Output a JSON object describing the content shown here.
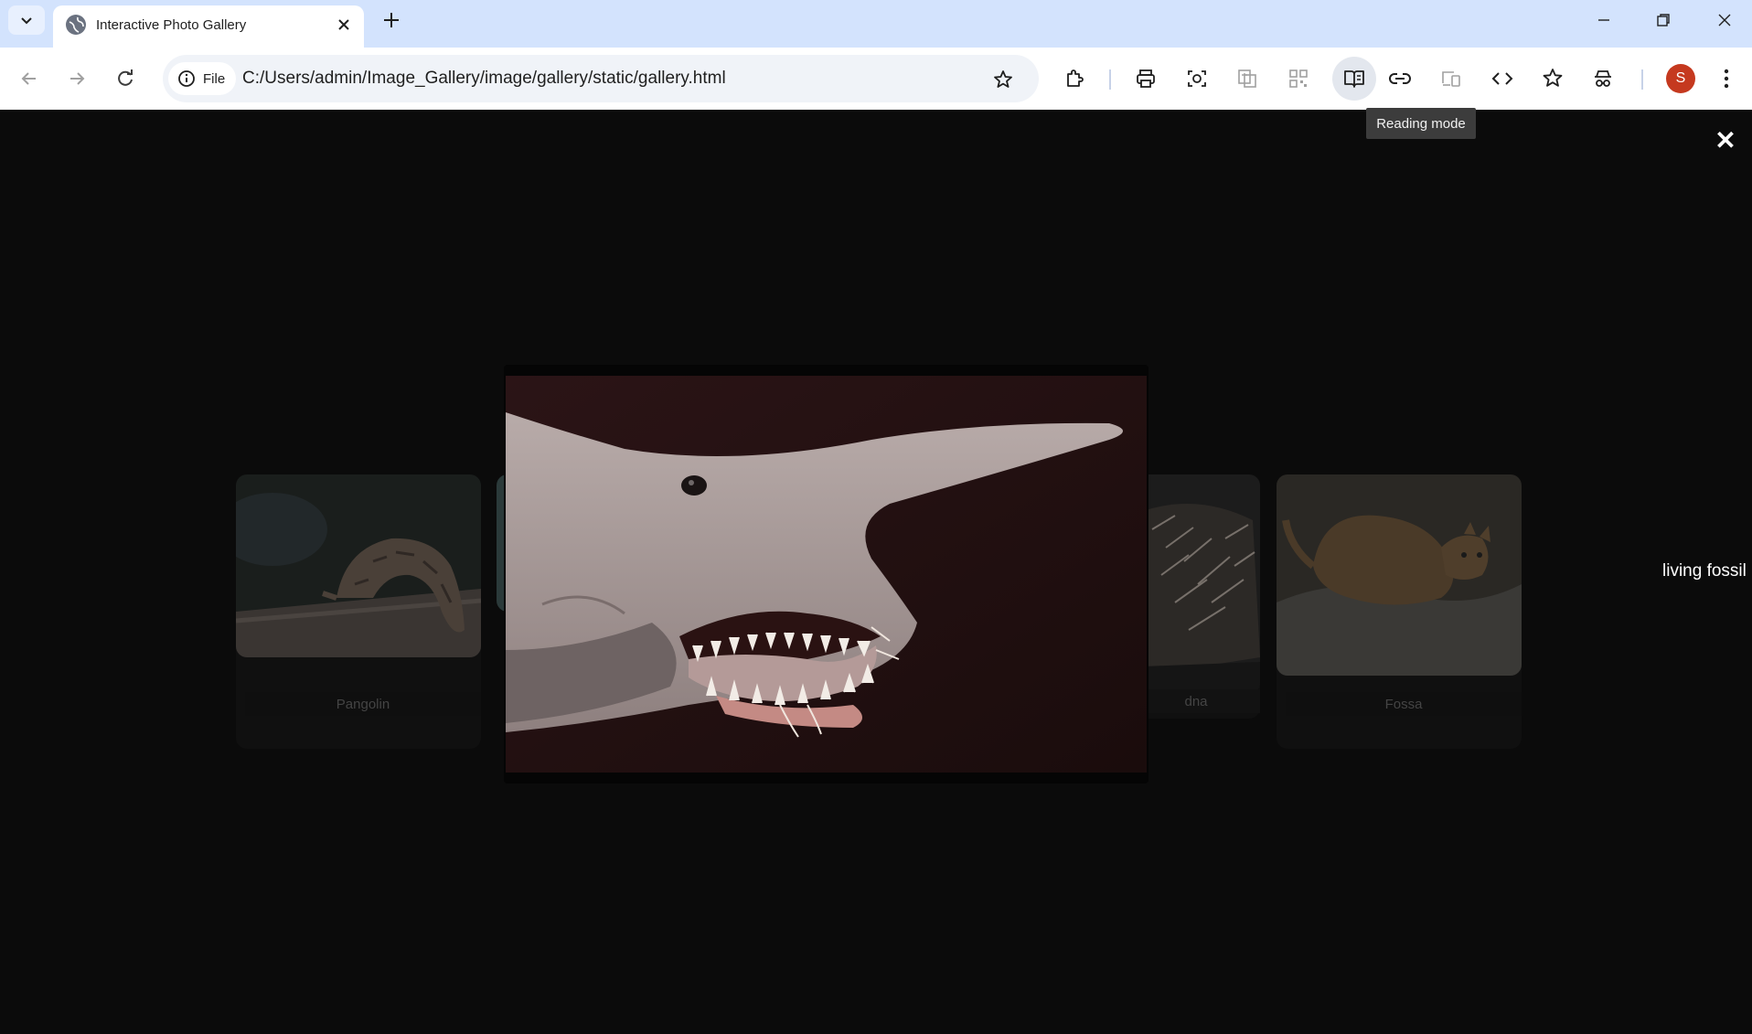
{
  "browser": {
    "tab_title": "Interactive Photo Gallery",
    "site_chip_label": "File",
    "url": "C:/Users/admin/Image_Gallery/image/gallery/static/gallery.html",
    "tooltip": "Reading mode",
    "avatar_initial": "S",
    "avatar_color": "#c5391f",
    "toolbar_icons": [
      "back-icon",
      "forward-icon",
      "reload-icon",
      "info-icon",
      "bookmark-star-icon",
      "extensions-icon",
      "print-icon",
      "screenshot-icon",
      "translate-icon",
      "qr-code-icon",
      "reading-mode-icon",
      "copy-link-icon",
      "cast-icon",
      "view-source-icon",
      "bookmarks-icon",
      "shopping-icon",
      "more-menu-icon"
    ]
  },
  "gallery": {
    "close_symbol": "✕",
    "cards": [
      {
        "caption": "Pangolin"
      },
      {
        "caption": "dna"
      },
      {
        "caption": "Fossa"
      }
    ],
    "featured_caption": "living fossil"
  }
}
